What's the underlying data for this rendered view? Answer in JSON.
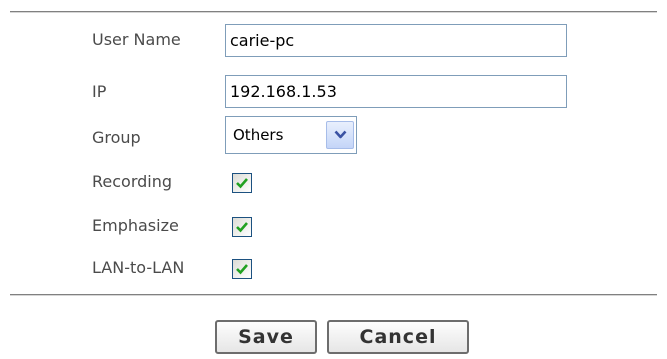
{
  "form": {
    "user_name": {
      "label": "User Name",
      "value": "carie-pc"
    },
    "ip": {
      "label": "IP",
      "value": "192.168.1.53"
    },
    "group": {
      "label": "Group",
      "selected": "Others"
    },
    "recording": {
      "label": "Recording",
      "checked": true
    },
    "emphasize": {
      "label": "Emphasize",
      "checked": true
    },
    "lan_to_lan": {
      "label": "LAN-to-LAN",
      "checked": true
    }
  },
  "actions": {
    "save_label": "Save",
    "cancel_label": "Cancel"
  },
  "colors": {
    "input_border": "#7f9db9",
    "check_mark": "#21a121",
    "label_text": "#4b4b4b"
  },
  "icons": {
    "dropdown": "chevron-down-icon",
    "check": "check-icon"
  }
}
